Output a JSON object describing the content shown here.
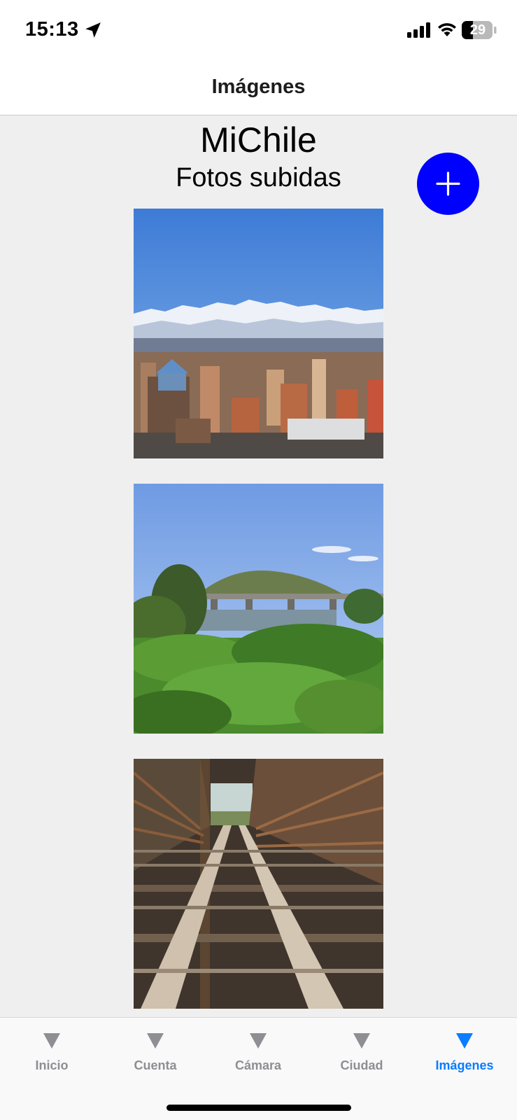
{
  "status_bar": {
    "time": "15:13",
    "battery_level": "29",
    "icons": [
      "location-arrow-icon",
      "cellular-signal-icon",
      "wifi-icon",
      "battery-icon"
    ]
  },
  "nav": {
    "title": "Imágenes"
  },
  "main": {
    "title": "MiChile",
    "subtitle": "Fotos subidas",
    "add_button_icon": "plus-icon",
    "add_button_color": "#0000ff",
    "photos": [
      {
        "subject": "city-skyline-with-snowy-andes"
      },
      {
        "subject": "river-bridge-with-green-trees-and-hill"
      },
      {
        "subject": "rusty-steel-railway-bridge"
      }
    ]
  },
  "tab_bar": {
    "active_color": "#0a7cff",
    "inactive_color": "#8e8e93",
    "tabs": [
      {
        "label": "Inicio",
        "active": false
      },
      {
        "label": "Cuenta",
        "active": false
      },
      {
        "label": "Cámara",
        "active": false
      },
      {
        "label": "Ciudad",
        "active": false
      },
      {
        "label": "Imágenes",
        "active": true
      }
    ]
  }
}
